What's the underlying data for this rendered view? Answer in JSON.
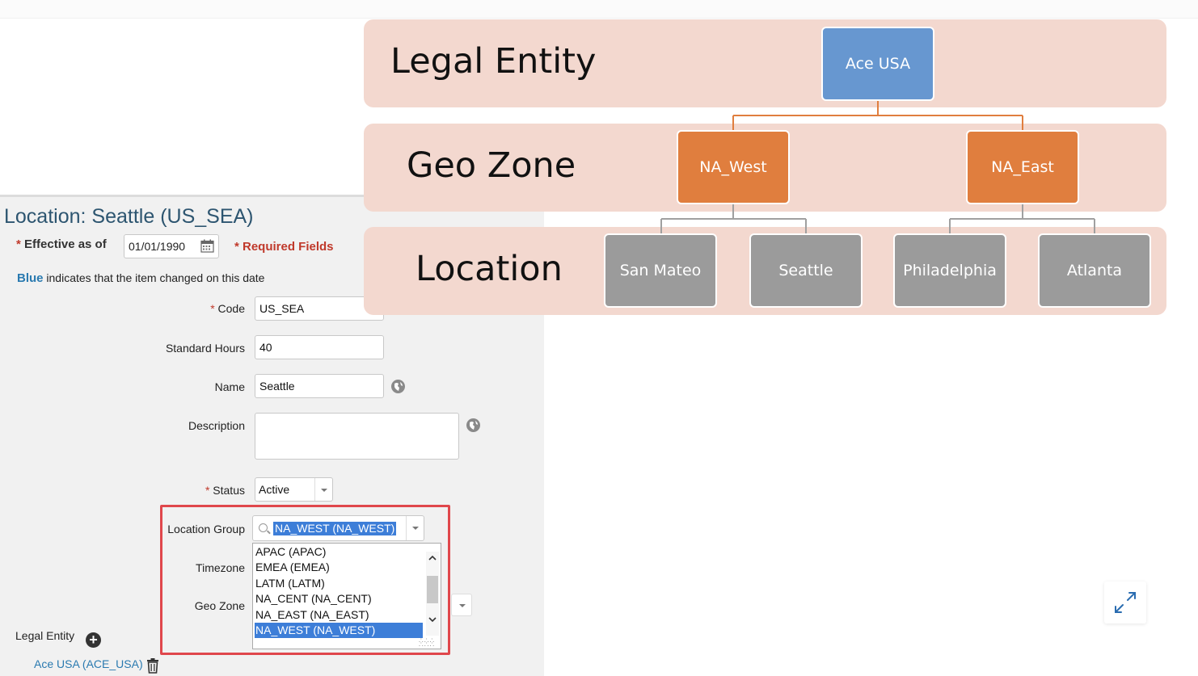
{
  "form": {
    "title": "Location: Seattle (US_SEA)",
    "effective_label": "Effective as of",
    "effective_date": "01/01/1990",
    "required_note": "* Required Fields",
    "blue_word": "Blue",
    "blue_note": " indicates that the item changed on this date",
    "code_label": "Code",
    "code_value": "US_SEA",
    "hours_label": "Standard Hours",
    "hours_value": "40",
    "name_label": "Name",
    "name_value": "Seattle",
    "description_label": "Description",
    "description_value": "",
    "status_label": "Status",
    "status_value": "Active",
    "location_group_label": "Location Group",
    "location_group_value": "NA_WEST (NA_WEST)",
    "location_group_options": [
      "APAC (APAC)",
      "EMEA (EMEA)",
      "LATM (LATM)",
      "NA_CENT (NA_CENT)",
      "NA_EAST (NA_EAST)",
      "NA_WEST (NA_WEST)"
    ],
    "timezone_label": "Timezone",
    "geo_zone_label": "Geo Zone",
    "legal_entity_label": "Legal Entity",
    "legal_entity_value": "Ace USA (ACE_USA)",
    "required_star": "*"
  },
  "org_chart": {
    "levels": {
      "legal_entity": "Legal Entity",
      "geo_zone": "Geo Zone",
      "location": "Location"
    },
    "nodes": {
      "ace_usa": "Ace USA",
      "na_west": "NA_West",
      "na_east": "NA_East",
      "san_mateo": "San Mateo",
      "seattle": "Seattle",
      "philadelphia": "Philadelphia",
      "atlanta": "Atlanta"
    },
    "colors": {
      "band": "#f3d8cf",
      "legal_entity_node": "#6797d0",
      "geo_zone_node": "#e07e3e",
      "location_node": "#9b9b9b",
      "connector_orange": "#e07e3e",
      "connector_gray": "#a0a0a0"
    }
  },
  "icons": {
    "calendar": "calendar-icon",
    "globe": "globe-icon",
    "search": "search-icon",
    "plus": "plus-icon",
    "trash": "trash-icon",
    "expand": "expand-icon"
  }
}
